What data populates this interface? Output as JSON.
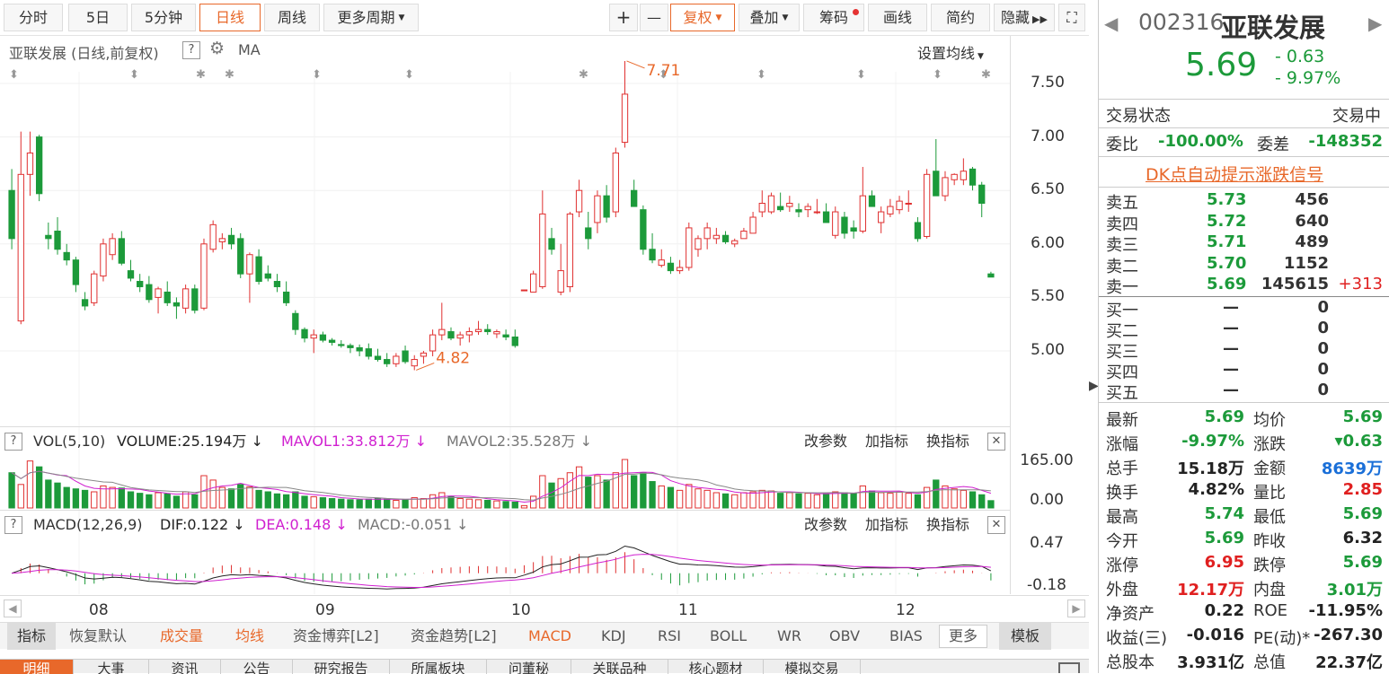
{
  "toolbar": {
    "period_buttons": [
      "分时",
      "5日",
      "5分钟",
      "日线",
      "周线",
      "更多周期"
    ],
    "active_period": "日线",
    "zoom_in": "+",
    "zoom_out": "—",
    "fuquan": "复权",
    "diejia": "叠加",
    "chouma": "筹码",
    "huaxian": "画线",
    "jianyue": "简约",
    "yincang": "隐藏"
  },
  "chart_header": {
    "title": "亚联发展 (日线,前复权)",
    "q": "?",
    "ma": "MA",
    "set_ma": "设置均线"
  },
  "price_axis": [
    "7.50",
    "7.00",
    "6.50",
    "6.00",
    "5.50",
    "5.00"
  ],
  "annotations": {
    "high": "7.71",
    "low": "4.82"
  },
  "vol_panel": {
    "q": "?",
    "name": "VOL(5,10)",
    "volume": "VOLUME:25.194万",
    "mavol1": "MAVOL1:33.812万",
    "mavol2": "MAVOL2:35.528万",
    "axis": [
      "165.00",
      "0.00"
    ],
    "buttons": [
      "改参数",
      "加指标",
      "换指标"
    ],
    "close": "✕"
  },
  "macd_panel": {
    "q": "?",
    "name": "MACD(12,26,9)",
    "dif": "DIF:0.122",
    "dea": "DEA:0.148",
    "macd": "MACD:-0.051",
    "axis": [
      "0.47",
      "-0.18"
    ],
    "buttons": [
      "改参数",
      "加指标",
      "换指标"
    ],
    "close": "✕"
  },
  "months": [
    "08",
    "09",
    "10",
    "11",
    "12"
  ],
  "bottom_bar": {
    "items": [
      "指标",
      "恢复默认",
      "成交量",
      "均线",
      "资金博弈[L2]",
      "资金趋势[L2]",
      "MACD",
      "KDJ",
      "RSI",
      "BOLL",
      "WR",
      "OBV",
      "BIAS"
    ],
    "more": "更多",
    "template": "模板"
  },
  "tabs": [
    "明细",
    "大事",
    "资讯",
    "公告",
    "研究报告",
    "所属板块",
    "问董秘",
    "关联品种",
    "核心题材",
    "模拟交易"
  ],
  "quote": {
    "code": "002316",
    "name": "亚联发展",
    "price": "5.69",
    "change": "- 0.63",
    "change_pct": "- 9.97%",
    "status_label": "交易状态",
    "status_value": "交易中",
    "weibi_label": "委比",
    "weibi_value": "-100.00%",
    "weicha_label": "委差",
    "weicha_value": "-148352",
    "dk_link": "DK点自动提示涨跌信号",
    "sells": [
      {
        "label": "卖五",
        "price": "5.73",
        "vol": "456",
        "chg": ""
      },
      {
        "label": "卖四",
        "price": "5.72",
        "vol": "640",
        "chg": ""
      },
      {
        "label": "卖三",
        "price": "5.71",
        "vol": "489",
        "chg": ""
      },
      {
        "label": "卖二",
        "price": "5.70",
        "vol": "1152",
        "chg": ""
      },
      {
        "label": "卖一",
        "price": "5.69",
        "vol": "145615",
        "chg": "+313"
      }
    ],
    "buys": [
      {
        "label": "买一",
        "price": "—",
        "vol": "0"
      },
      {
        "label": "买二",
        "price": "—",
        "vol": "0"
      },
      {
        "label": "买三",
        "price": "—",
        "vol": "0"
      },
      {
        "label": "买四",
        "price": "—",
        "vol": "0"
      },
      {
        "label": "买五",
        "price": "—",
        "vol": "0"
      }
    ],
    "stats": [
      {
        "l1": "最新",
        "v1": "5.69",
        "c1": "green",
        "l2": "均价",
        "v2": "5.69",
        "c2": "green"
      },
      {
        "l1": "涨幅",
        "v1": "-9.97%",
        "c1": "green",
        "l2": "涨跌",
        "v2": "▾0.63",
        "c2": "green"
      },
      {
        "l1": "总手",
        "v1": "15.18万",
        "c1": "",
        "l2": "金额",
        "v2": "8639万",
        "c2": "blue"
      },
      {
        "l1": "换手",
        "v1": "4.82%",
        "c1": "",
        "l2": "量比",
        "v2": "2.85",
        "c2": "red2"
      },
      {
        "l1": "最高",
        "v1": "5.74",
        "c1": "green",
        "l2": "最低",
        "v2": "5.69",
        "c2": "green"
      },
      {
        "l1": "今开",
        "v1": "5.69",
        "c1": "green",
        "l2": "昨收",
        "v2": "6.32",
        "c2": ""
      },
      {
        "l1": "涨停",
        "v1": "6.95",
        "c1": "red2",
        "l2": "跌停",
        "v2": "5.69",
        "c2": "green"
      },
      {
        "l1": "外盘",
        "v1": "12.17万",
        "c1": "red2",
        "l2": "内盘",
        "v2": "3.01万",
        "c2": "green"
      },
      {
        "l1": "净资产",
        "v1": "0.22",
        "c1": "",
        "l2": "ROE",
        "v2": "-11.95%",
        "c2": ""
      },
      {
        "l1": "收益(三)",
        "v1": "-0.016",
        "c1": "",
        "l2": "PE(动)*",
        "v2": "-267.30",
        "c2": ""
      },
      {
        "l1": "总股本",
        "v1": "3.931亿",
        "c1": "",
        "l2": "总值",
        "v2": "22.37亿",
        "c2": ""
      }
    ]
  },
  "colors": {
    "up": "#e03030",
    "down": "#1c9a3a",
    "accent": "#e8682a",
    "mavol1": "#d020d0"
  },
  "chart_data": {
    "type": "candlestick",
    "title": "亚联发展 (日线,前复权)",
    "ylim": [
      4.7,
      7.85
    ],
    "x_month_labels": [
      "08",
      "09",
      "10",
      "11",
      "12"
    ],
    "ohlc": [
      [
        6.5,
        6.7,
        5.95,
        6.05
      ],
      [
        5.28,
        7.05,
        5.25,
        6.65
      ],
      [
        6.65,
        7.05,
        6.45,
        6.85
      ],
      [
        7.0,
        7.02,
        6.4,
        6.47
      ],
      [
        6.08,
        6.2,
        5.95,
        6.05
      ],
      [
        6.12,
        6.25,
        5.9,
        5.95
      ],
      [
        5.92,
        6.0,
        5.8,
        5.85
      ],
      [
        5.85,
        5.88,
        5.55,
        5.62
      ],
      [
        5.48,
        5.55,
        5.38,
        5.42
      ],
      [
        5.45,
        5.75,
        5.42,
        5.72
      ],
      [
        5.7,
        6.05,
        5.65,
        6.0
      ],
      [
        5.9,
        6.1,
        5.85,
        6.05
      ],
      [
        6.05,
        6.12,
        5.8,
        5.82
      ],
      [
        5.75,
        5.85,
        5.65,
        5.68
      ],
      [
        5.65,
        5.72,
        5.55,
        5.6
      ],
      [
        5.62,
        5.7,
        5.45,
        5.48
      ],
      [
        5.5,
        5.6,
        5.35,
        5.58
      ],
      [
        5.55,
        5.65,
        5.42,
        5.45
      ],
      [
        5.45,
        5.5,
        5.3,
        5.42
      ],
      [
        5.4,
        5.62,
        5.35,
        5.58
      ],
      [
        5.58,
        5.62,
        5.35,
        5.38
      ],
      [
        5.4,
        6.05,
        5.38,
        6.0
      ],
      [
        5.95,
        6.22,
        5.92,
        6.18
      ],
      [
        6.02,
        6.1,
        5.95,
        6.05
      ],
      [
        6.08,
        6.15,
        5.95,
        6.0
      ],
      [
        6.05,
        6.1,
        5.68,
        5.72
      ],
      [
        5.72,
        5.92,
        5.45,
        5.9
      ],
      [
        5.88,
        5.95,
        5.62,
        5.65
      ],
      [
        5.72,
        5.8,
        5.65,
        5.68
      ],
      [
        5.65,
        5.72,
        5.55,
        5.6
      ],
      [
        5.55,
        5.65,
        5.42,
        5.45
      ],
      [
        5.35,
        5.38,
        5.15,
        5.2
      ],
      [
        5.2,
        5.22,
        5.08,
        5.12
      ],
      [
        5.12,
        5.2,
        4.98,
        5.15
      ],
      [
        5.15,
        5.18,
        5.08,
        5.1
      ],
      [
        5.1,
        5.12,
        5.05,
        5.08
      ],
      [
        5.06,
        5.1,
        5.03,
        5.05
      ],
      [
        5.05,
        5.07,
        4.98,
        5.03
      ],
      [
        5.03,
        5.06,
        4.95,
        5.0
      ],
      [
        5.02,
        5.07,
        4.92,
        4.95
      ],
      [
        4.95,
        5.02,
        4.9,
        4.92
      ],
      [
        4.92,
        4.98,
        4.85,
        4.88
      ],
      [
        4.88,
        4.98,
        4.85,
        4.95
      ],
      [
        5.0,
        5.05,
        4.88,
        4.9
      ],
      [
        4.86,
        4.96,
        4.82,
        4.92
      ],
      [
        4.95,
        5.0,
        4.88,
        4.98
      ],
      [
        5.0,
        5.2,
        4.95,
        5.15
      ],
      [
        5.15,
        5.45,
        5.1,
        5.2
      ],
      [
        5.18,
        5.22,
        5.1,
        5.12
      ],
      [
        5.12,
        5.18,
        5.05,
        5.15
      ],
      [
        5.15,
        5.22,
        5.08,
        5.18
      ],
      [
        5.18,
        5.28,
        5.15,
        5.2
      ],
      [
        5.2,
        5.25,
        5.15,
        5.18
      ],
      [
        5.16,
        5.2,
        5.12,
        5.18
      ],
      [
        5.15,
        5.2,
        5.1,
        5.13
      ],
      [
        5.13,
        5.2,
        5.03,
        5.05
      ],
      [
        5.57,
        5.57,
        5.57,
        5.57
      ],
      [
        5.55,
        5.75,
        5.55,
        5.72
      ],
      [
        5.6,
        6.5,
        5.58,
        6.28
      ],
      [
        6.05,
        6.15,
        5.9,
        5.95
      ],
      [
        5.55,
        6.0,
        5.52,
        5.75
      ],
      [
        5.6,
        6.3,
        5.55,
        6.28
      ],
      [
        6.3,
        6.6,
        6.25,
        6.5
      ],
      [
        6.15,
        6.3,
        5.95,
        6.05
      ],
      [
        6.2,
        6.5,
        6.1,
        6.45
      ],
      [
        6.45,
        6.55,
        6.2,
        6.25
      ],
      [
        6.3,
        6.9,
        6.25,
        6.85
      ],
      [
        6.95,
        7.71,
        6.9,
        7.4
      ],
      [
        6.5,
        6.6,
        6.35,
        6.35
      ],
      [
        6.32,
        6.36,
        5.9,
        5.95
      ],
      [
        5.95,
        6.1,
        5.82,
        5.85
      ],
      [
        5.8,
        5.95,
        5.78,
        5.85
      ],
      [
        5.82,
        5.88,
        5.72,
        5.75
      ],
      [
        5.75,
        5.85,
        5.72,
        5.78
      ],
      [
        5.78,
        6.2,
        5.75,
        6.15
      ],
      [
        5.95,
        6.08,
        5.88,
        6.05
      ],
      [
        6.05,
        6.2,
        5.95,
        6.15
      ],
      [
        6.05,
        6.15,
        6.0,
        6.08
      ],
      [
        6.08,
        6.12,
        6.0,
        6.02
      ],
      [
        6.0,
        6.05,
        5.97,
        6.03
      ],
      [
        6.05,
        6.15,
        6.05,
        6.12
      ],
      [
        6.1,
        6.3,
        6.1,
        6.25
      ],
      [
        6.3,
        6.5,
        6.25,
        6.38
      ],
      [
        6.3,
        6.48,
        6.28,
        6.45
      ],
      [
        6.35,
        6.48,
        6.3,
        6.32
      ],
      [
        6.35,
        6.45,
        6.3,
        6.38
      ],
      [
        6.32,
        6.38,
        6.25,
        6.3
      ],
      [
        6.32,
        6.38,
        6.25,
        6.35
      ],
      [
        6.3,
        6.42,
        6.28,
        6.3
      ],
      [
        6.3,
        6.38,
        6.2,
        6.2
      ],
      [
        6.08,
        6.35,
        6.05,
        6.3
      ],
      [
        6.25,
        6.3,
        6.05,
        6.1
      ],
      [
        6.15,
        6.22,
        6.05,
        6.12
      ],
      [
        6.12,
        6.72,
        6.1,
        6.45
      ],
      [
        6.45,
        6.5,
        6.35,
        6.35
      ],
      [
        6.2,
        6.35,
        6.1,
        6.3
      ],
      [
        6.28,
        6.42,
        6.25,
        6.35
      ],
      [
        6.32,
        6.45,
        6.28,
        6.4
      ],
      [
        6.38,
        6.5,
        6.3,
        6.38
      ],
      [
        6.2,
        6.25,
        6.02,
        6.05
      ],
      [
        6.07,
        6.7,
        6.05,
        6.65
      ],
      [
        6.68,
        6.98,
        6.5,
        6.45
      ],
      [
        6.45,
        6.68,
        6.4,
        6.62
      ],
      [
        6.6,
        6.66,
        6.55,
        6.65
      ],
      [
        6.6,
        6.8,
        6.55,
        6.68
      ],
      [
        6.7,
        6.72,
        6.5,
        6.55
      ],
      [
        6.55,
        6.58,
        6.25,
        6.38
      ],
      [
        5.72,
        5.74,
        5.69,
        5.69
      ]
    ],
    "volume_wan": [
      120,
      80,
      160,
      140,
      95,
      85,
      70,
      65,
      60,
      55,
      75,
      70,
      68,
      55,
      50,
      45,
      52,
      48,
      40,
      55,
      45,
      110,
      95,
      70,
      65,
      80,
      72,
      60,
      55,
      48,
      45,
      55,
      40,
      38,
      35,
      32,
      30,
      28,
      28,
      30,
      32,
      30,
      26,
      28,
      35,
      32,
      45,
      52,
      40,
      32,
      30,
      28,
      26,
      24,
      22,
      20,
      8,
      40,
      110,
      85,
      100,
      120,
      140,
      105,
      110,
      95,
      120,
      165,
      110,
      120,
      90,
      75,
      70,
      60,
      80,
      65,
      60,
      52,
      48,
      45,
      52,
      55,
      60,
      58,
      50,
      52,
      48,
      50,
      45,
      48,
      55,
      52,
      50,
      75,
      58,
      52,
      50,
      54,
      50,
      45,
      70,
      95,
      75,
      65,
      60,
      55,
      45,
      25
    ]
  }
}
